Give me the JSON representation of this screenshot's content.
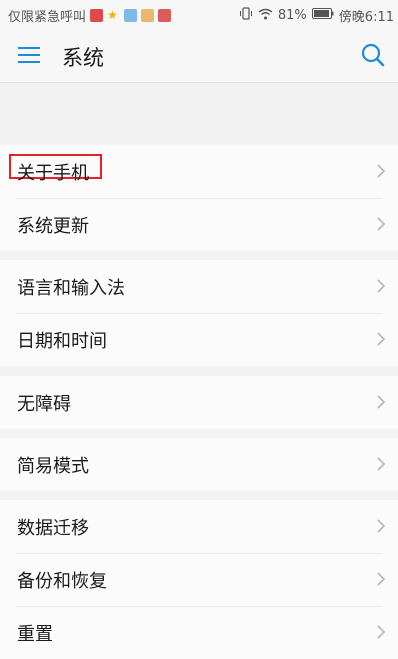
{
  "status_bar": {
    "left_text": "仅限紧急呼叫",
    "battery": "81%",
    "time": "傍晚6:11"
  },
  "header": {
    "title": "系统",
    "menu_icon": "menu-icon",
    "search_icon": "search-icon"
  },
  "groups": [
    {
      "items": [
        {
          "label": "关于手机"
        },
        {
          "label": "系统更新"
        }
      ]
    },
    {
      "items": [
        {
          "label": "语言和输入法"
        },
        {
          "label": "日期和时间"
        }
      ]
    },
    {
      "items": [
        {
          "label": "无障碍"
        }
      ]
    },
    {
      "items": [
        {
          "label": "简易模式"
        }
      ]
    },
    {
      "items": [
        {
          "label": "数据迁移"
        },
        {
          "label": "备份和恢复"
        },
        {
          "label": "重置"
        }
      ]
    }
  ],
  "colors": {
    "accent": "#1a8cd8",
    "highlight_box": "#e52228"
  }
}
